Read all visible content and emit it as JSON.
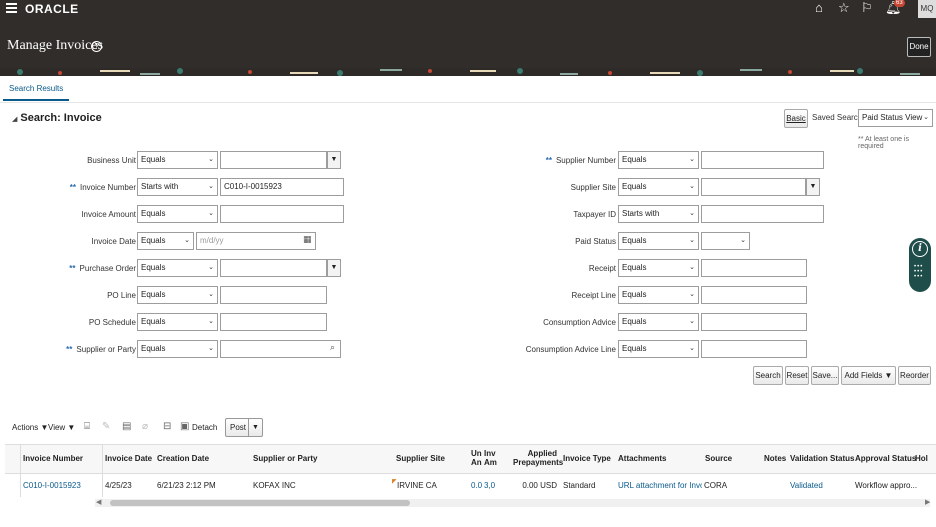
{
  "global": {
    "brand": "ORACLE",
    "notification_count": "63",
    "user_initials": "MQ"
  },
  "header": {
    "title": "Manage Invoices",
    "done_label": "Done"
  },
  "tabs": [
    {
      "label": "Search Results"
    }
  ],
  "search": {
    "title": "Search: Invoice",
    "basic_label": "Basic",
    "saved_search_label": "Saved Search",
    "saved_search_value": "Paid Status View",
    "required_note": "** At least one is required",
    "left_fields": [
      {
        "label": "Business Unit",
        "required": false,
        "operator": "Equals",
        "value": "",
        "kind": "combo"
      },
      {
        "label": "Invoice Number",
        "required": true,
        "operator": "Starts with",
        "value": "C010-I-0015923",
        "kind": "text"
      },
      {
        "label": "Invoice Amount",
        "required": false,
        "operator": "Equals",
        "value": "",
        "kind": "text"
      },
      {
        "label": "Invoice Date",
        "required": false,
        "operator": "Equals",
        "value": "",
        "placeholder": "m/d/yy",
        "kind": "date"
      },
      {
        "label": "Purchase Order",
        "required": true,
        "operator": "Equals",
        "value": "",
        "kind": "combo"
      },
      {
        "label": "PO Line",
        "required": false,
        "operator": "Equals",
        "value": "",
        "kind": "text"
      },
      {
        "label": "PO Schedule",
        "required": false,
        "operator": "Equals",
        "value": "",
        "kind": "text"
      },
      {
        "label": "Supplier or Party",
        "required": true,
        "operator": "Equals",
        "value": "",
        "kind": "search"
      }
    ],
    "right_fields": [
      {
        "label": "Supplier Number",
        "required": true,
        "operator": "Equals",
        "value": "",
        "kind": "text"
      },
      {
        "label": "Supplier Site",
        "required": false,
        "operator": "Equals",
        "value": "",
        "kind": "combo"
      },
      {
        "label": "Taxpayer ID",
        "required": false,
        "operator": "Starts with",
        "value": "",
        "kind": "text"
      },
      {
        "label": "Paid Status",
        "required": false,
        "operator": "Equals",
        "value": "",
        "kind": "select"
      },
      {
        "label": "Receipt",
        "required": false,
        "operator": "Equals",
        "value": "",
        "kind": "text"
      },
      {
        "label": "Receipt Line",
        "required": false,
        "operator": "Equals",
        "value": "",
        "kind": "text"
      },
      {
        "label": "Consumption Advice",
        "required": false,
        "operator": "Equals",
        "value": "",
        "kind": "text"
      },
      {
        "label": "Consumption Advice Line",
        "required": false,
        "operator": "Equals",
        "value": "",
        "kind": "text"
      }
    ],
    "buttons": {
      "search": "Search",
      "reset": "Reset",
      "save": "Save...",
      "add_fields": "Add Fields",
      "reorder": "Reorder"
    }
  },
  "toolbar": {
    "actions": "Actions",
    "view": "View",
    "detach": "Detach",
    "post": "Post"
  },
  "table": {
    "columns": {
      "invoice_number": "Invoice Number",
      "invoice_date": "Invoice Date",
      "creation_date": "Creation Date",
      "supplier": "Supplier or Party",
      "supplier_site": "Supplier Site",
      "un_line1": "Un",
      "un_line2": "An",
      "inv_line1": "Inv",
      "inv_line2": "Am",
      "applied_line1": "Applied",
      "applied_line2": "Prepayments",
      "invoice_type": "Invoice Type",
      "attachments": "Attachments",
      "source": "Source",
      "notes": "Notes",
      "validation_status": "Validation Status",
      "approval_status": "Approval Status",
      "hold": "Hol"
    },
    "rows": [
      {
        "invoice_number": "C010-I-0015923",
        "invoice_date": "4/25/23",
        "creation_date": "6/21/23 2:12 PM",
        "supplier": "KOFAX INC",
        "supplier_site": "IRVINE CA",
        "unpaid_amount": "0.0",
        "invoice_amount": "3,0",
        "applied_prepayments": "0.00 USD",
        "invoice_type": "Standard",
        "attachments": "URL attachment for Invoice C",
        "source": "CORA",
        "validation_status": "Validated",
        "approval_status": "Workflow appro..."
      }
    ]
  }
}
